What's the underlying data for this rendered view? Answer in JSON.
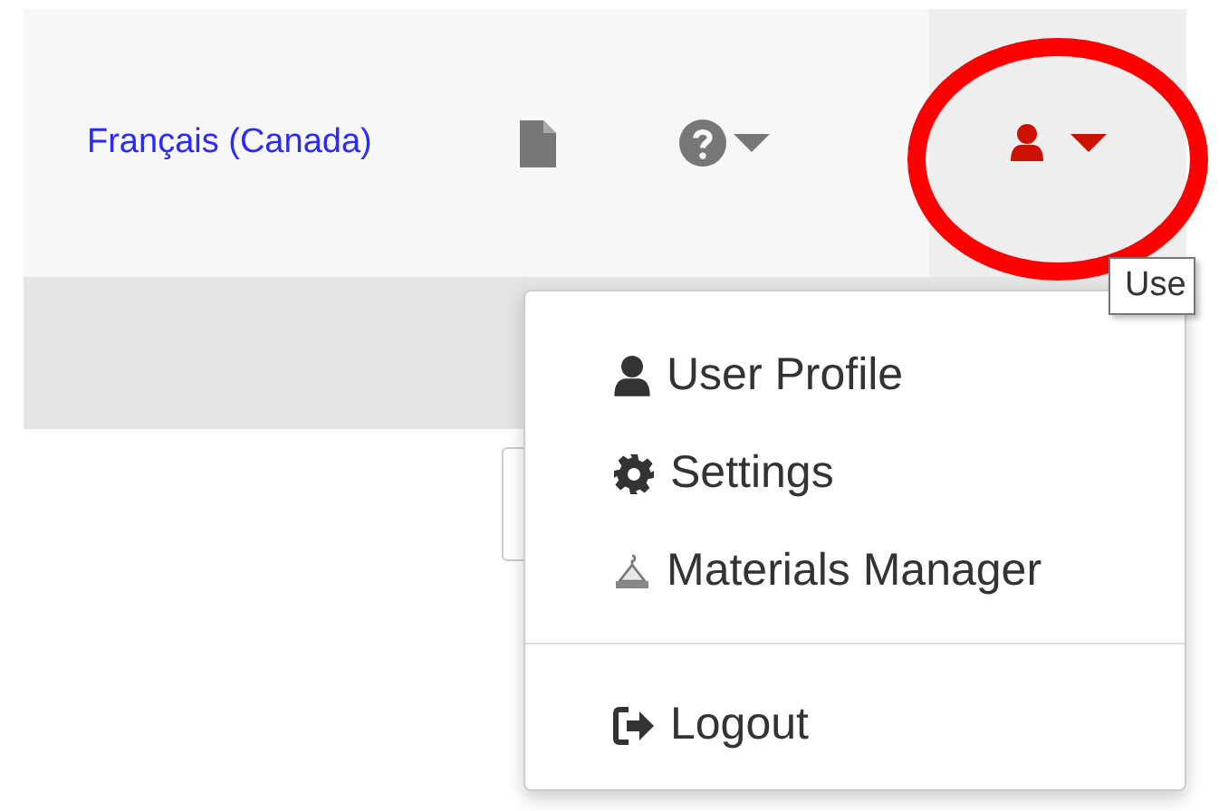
{
  "navbar": {
    "language_link": "Français (Canada)"
  },
  "tooltip": "Use",
  "user_menu": {
    "sections": [
      {
        "items": [
          "User Profile",
          "Settings",
          "Materials Manager"
        ]
      },
      {
        "items": [
          "Logout"
        ]
      }
    ]
  }
}
